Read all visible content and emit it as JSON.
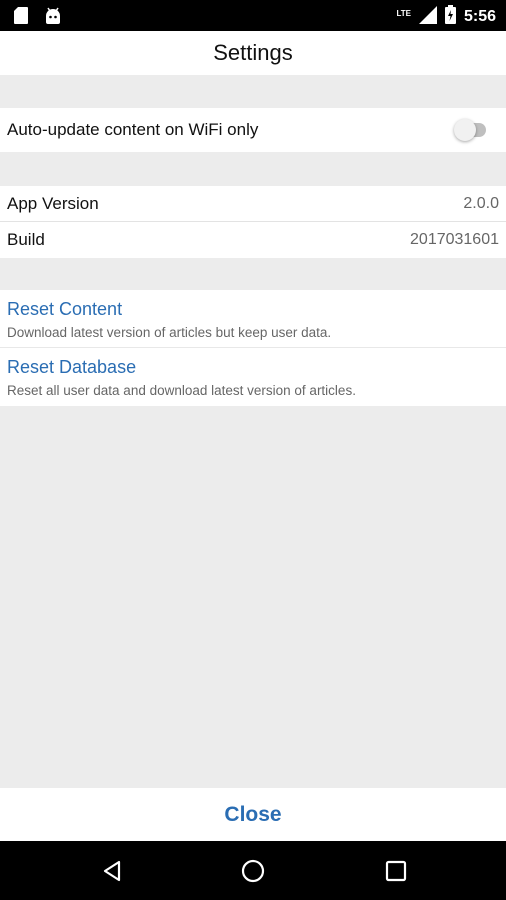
{
  "status_bar": {
    "time": "5:56",
    "network": "LTE",
    "icons": [
      "sd-card-icon",
      "android-icon",
      "signal-icon",
      "battery-icon"
    ]
  },
  "header": {
    "title": "Settings"
  },
  "settings": {
    "auto_update": {
      "label": "Auto-update content on WiFi only",
      "enabled": false
    },
    "app_version": {
      "label": "App Version",
      "value": "2.0.0"
    },
    "build": {
      "label": "Build",
      "value": "2017031601"
    }
  },
  "actions": [
    {
      "title": "Reset Content",
      "description": "Download latest version of articles but keep user data."
    },
    {
      "title": "Reset Database",
      "description": "Reset all user data and download latest version of articles."
    }
  ],
  "footer": {
    "close_label": "Close"
  },
  "nav_bar": {
    "icons": [
      "back-icon",
      "home-icon",
      "recents-icon"
    ]
  },
  "colors": {
    "accent": "#2a6db3",
    "background": "#ececec",
    "status_bar": "#000000"
  }
}
